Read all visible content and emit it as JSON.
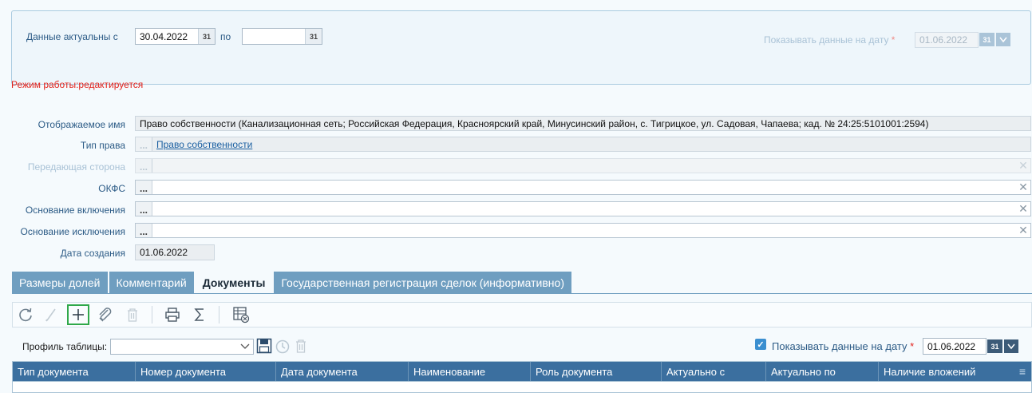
{
  "filter": {
    "actual_from_label": "Данные актуальны с",
    "actual_from_value": "30.04.2022",
    "to_label": "по",
    "to_value": "",
    "show_on_date_label": "Показывать данные на дату",
    "show_on_date_value": "01.06.2022",
    "calendar_glyph": "31"
  },
  "mode_text": "Режим работы:редактируется",
  "form": {
    "display_name_label": "Отображаемое имя",
    "display_name_value": "Право собственности (Канализационная сеть; Российская Федерация, Красноярский край, Минусинский район, с. Тигрицкое, ул. Садовая, Чапаева; кад. № 24:25:5101001:2594)",
    "right_type_label": "Тип права",
    "right_type_value": "Право собственности",
    "transferring_party_label": "Передающая сторона",
    "okfs_label": "ОКФС",
    "inclusion_basis_label": "Основание включения",
    "exclusion_basis_label": "Основание исключения",
    "created_date_label": "Дата создания",
    "created_date_value": "01.06.2022",
    "dots": "..."
  },
  "tabs": [
    {
      "label": "Размеры долей"
    },
    {
      "label": "Комментарий"
    },
    {
      "label": "Документы"
    },
    {
      "label": "Государственная регистрация сделок (информативно)"
    }
  ],
  "table_controls": {
    "profile_label": "Профиль таблицы:",
    "show_on_date_label": "Показывать данные на дату",
    "show_on_date_value": "01.06.2022"
  },
  "grid": {
    "columns": [
      "Тип документа",
      "Номер документа",
      "Дата документа",
      "Наименование",
      "Роль документа",
      "Актуально с",
      "Актуально по",
      "Наличие вложений"
    ]
  },
  "colors": {
    "accent": "#3b6f9f",
    "tab": "#6f9ec0",
    "mode": "#e3221c",
    "highlight": "#2fa84a"
  }
}
